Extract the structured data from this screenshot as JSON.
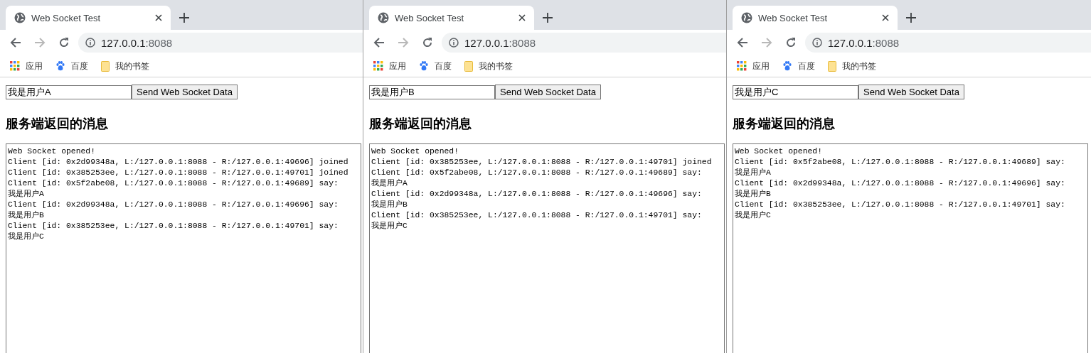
{
  "windows": [
    {
      "tab": {
        "title": "Web Socket Test"
      },
      "url": {
        "host": "127.0.0.1",
        "port": ":8088"
      },
      "bookmarks": [
        {
          "kind": "apps",
          "label": "应用"
        },
        {
          "kind": "paw",
          "label": "百度"
        },
        {
          "kind": "folder",
          "label": "我的书签"
        }
      ],
      "message_input": {
        "value": "我是用户A"
      },
      "send_button": "Send Web Socket Data",
      "heading": "服务端返回的消息",
      "log": [
        "Web Socket opened!",
        "Client [id: 0x2d99348a, L:/127.0.0.1:8088 - R:/127.0.0.1:49696] joined",
        "Client [id: 0x385253ee, L:/127.0.0.1:8088 - R:/127.0.0.1:49701] joined",
        "Client [id: 0x5f2abe08, L:/127.0.0.1:8088 - R:/127.0.0.1:49689] say:",
        "我是用户A",
        "Client [id: 0x2d99348a, L:/127.0.0.1:8088 - R:/127.0.0.1:49696] say:",
        "我是用户B",
        "Client [id: 0x385253ee, L:/127.0.0.1:8088 - R:/127.0.0.1:49701] say:",
        "我是用户C"
      ]
    },
    {
      "tab": {
        "title": "Web Socket Test"
      },
      "url": {
        "host": "127.0.0.1",
        "port": ":8088"
      },
      "bookmarks": [
        {
          "kind": "apps",
          "label": "应用"
        },
        {
          "kind": "paw",
          "label": "百度"
        },
        {
          "kind": "folder",
          "label": "我的书签"
        }
      ],
      "message_input": {
        "value": "我是用户B"
      },
      "send_button": "Send Web Socket Data",
      "heading": "服务端返回的消息",
      "log": [
        "Web Socket opened!",
        "Client [id: 0x385253ee, L:/127.0.0.1:8088 - R:/127.0.0.1:49701] joined",
        "Client [id: 0x5f2abe08, L:/127.0.0.1:8088 - R:/127.0.0.1:49689] say:",
        "我是用户A",
        "Client [id: 0x2d99348a, L:/127.0.0.1:8088 - R:/127.0.0.1:49696] say:",
        "我是用户B",
        "Client [id: 0x385253ee, L:/127.0.0.1:8088 - R:/127.0.0.1:49701] say:",
        "我是用户C"
      ]
    },
    {
      "tab": {
        "title": "Web Socket Test"
      },
      "url": {
        "host": "127.0.0.1",
        "port": ":8088"
      },
      "bookmarks": [
        {
          "kind": "apps",
          "label": "应用"
        },
        {
          "kind": "paw",
          "label": "百度"
        },
        {
          "kind": "folder",
          "label": "我的书签"
        }
      ],
      "message_input": {
        "value": "我是用户C"
      },
      "send_button": "Send Web Socket Data",
      "heading": "服务端返回的消息",
      "log": [
        "Web Socket opened!",
        "Client [id: 0x5f2abe08, L:/127.0.0.1:8088 - R:/127.0.0.1:49689] say:",
        "我是用户A",
        "Client [id: 0x2d99348a, L:/127.0.0.1:8088 - R:/127.0.0.1:49696] say:",
        "我是用户B",
        "Client [id: 0x385253ee, L:/127.0.0.1:8088 - R:/127.0.0.1:49701] say:",
        "我是用户C"
      ]
    }
  ]
}
